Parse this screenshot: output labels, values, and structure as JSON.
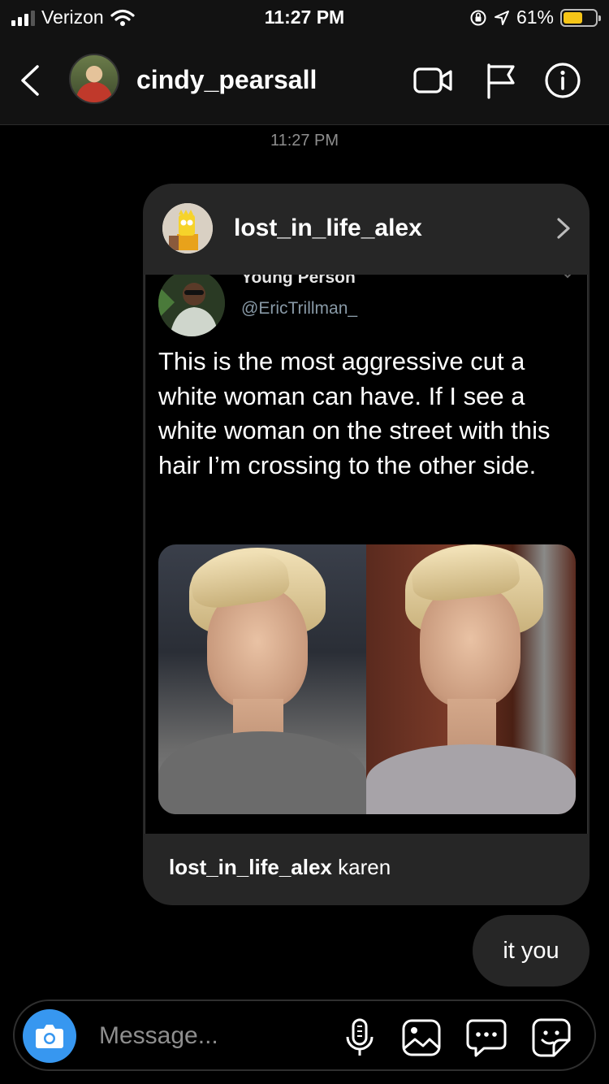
{
  "status_bar": {
    "carrier": "Verizon",
    "time": "11:27 PM",
    "battery": "61%",
    "battery_level": 0.61
  },
  "header": {
    "username": "cindy_pearsall",
    "icons": [
      "back-chevron-icon",
      "video-call-icon",
      "flag-icon",
      "info-icon"
    ]
  },
  "thread": {
    "timestamp": "11:27 PM"
  },
  "shared_post": {
    "username": "lost_in_life_alex",
    "tweet": {
      "name": "Young Person",
      "handle": "@EricTrillman_",
      "text": "This is the most aggressive cut a white woman can have. If I see a white woman on the street with this hair I’m crossing to the other side."
    },
    "caption_user": "lost_in_life_alex",
    "caption_text": " karen"
  },
  "reply": {
    "text": "it you"
  },
  "composer": {
    "placeholder": "Message...",
    "icons": [
      "camera-icon",
      "microphone-icon",
      "gallery-icon",
      "chat-bubble-icon",
      "sticker-icon"
    ],
    "accent_color": "#3797f0"
  }
}
